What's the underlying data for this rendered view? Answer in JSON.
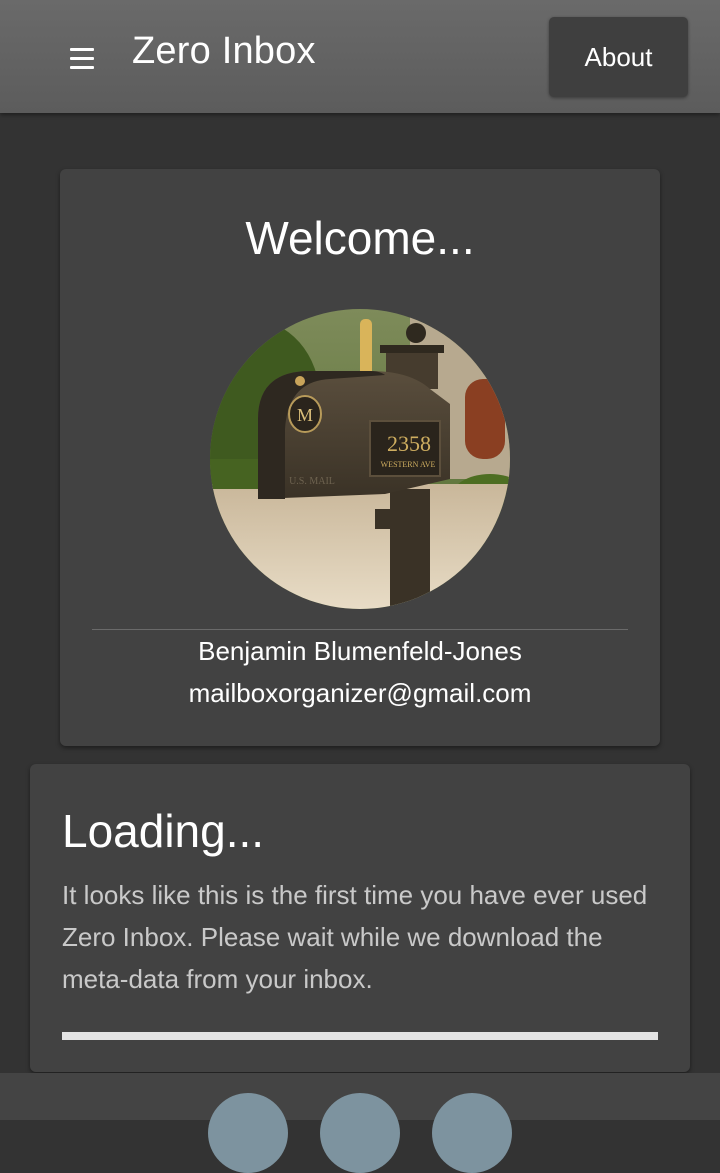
{
  "header": {
    "title": "Zero Inbox",
    "about_label": "About"
  },
  "welcome": {
    "title": "Welcome...",
    "user_name": "Benjamin Blumenfeld-Jones",
    "user_email": "mailboxorganizer@gmail.com",
    "mailbox_number": "2358",
    "mailbox_street": "WESTERN AVE",
    "mailbox_monogram": "M",
    "mailbox_brand": "U.S. MAIL"
  },
  "loading": {
    "title": "Loading...",
    "message": "It looks like this is the first time you have ever used Zero Inbox. Please wait while we download the meta-data from your inbox.",
    "progress": 1.0
  },
  "bottom_nav": {
    "buttons": [
      "nav-button-1",
      "nav-button-2",
      "nav-button-3"
    ]
  },
  "colors": {
    "background": "#333333",
    "header": "#616161",
    "card": "#424242",
    "fab": "#7d939f"
  }
}
